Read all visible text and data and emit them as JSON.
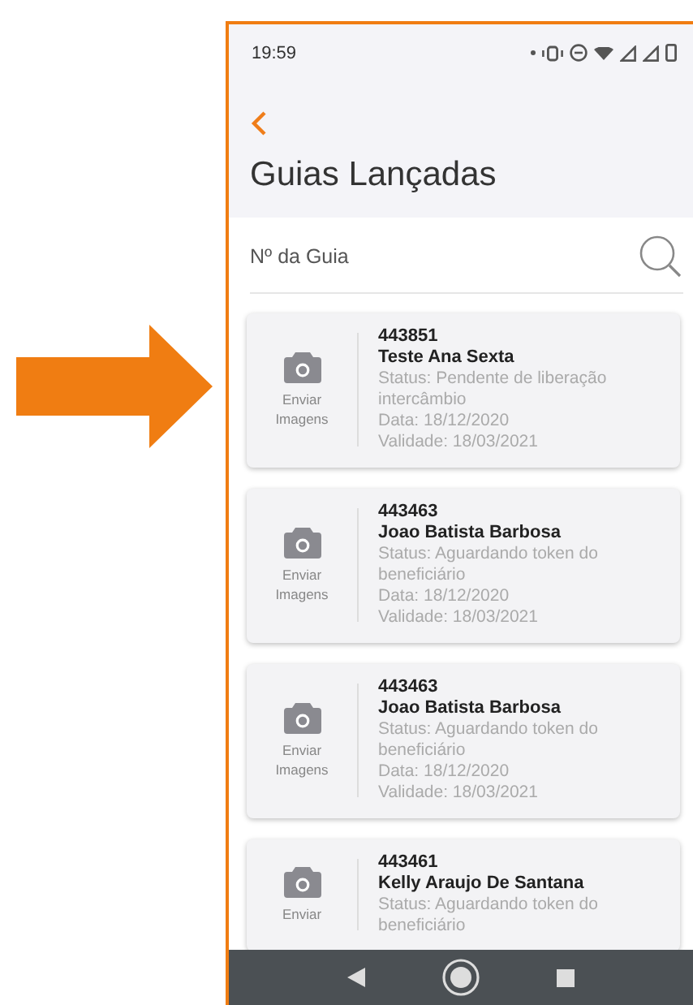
{
  "status_bar": {
    "time": "19:59"
  },
  "header": {
    "title": "Guias Lançadas"
  },
  "search": {
    "placeholder": "Nº da Guia"
  },
  "guides": [
    {
      "number": "443851",
      "name": "Teste Ana Sexta",
      "status": "Status: Pendente de liberação intercâmbio",
      "date": "Data: 18/12/2020",
      "validity": "Validade: 18/03/2021",
      "action": "Enviar Imagens"
    },
    {
      "number": "443463",
      "name": "Joao Batista Barbosa",
      "status": "Status: Aguardando token do beneficiário",
      "date": "Data: 18/12/2020",
      "validity": "Validade: 18/03/2021",
      "action": "Enviar Imagens"
    },
    {
      "number": "443463",
      "name": "Joao Batista Barbosa",
      "status": "Status: Aguardando token do beneficiário",
      "date": "Data: 18/12/2020",
      "validity": "Validade: 18/03/2021",
      "action": "Enviar Imagens"
    },
    {
      "number": "443461",
      "name": "Kelly Araujo De Santana",
      "status": "Status: Aguardando token do beneficiário",
      "action": "Enviar"
    }
  ]
}
